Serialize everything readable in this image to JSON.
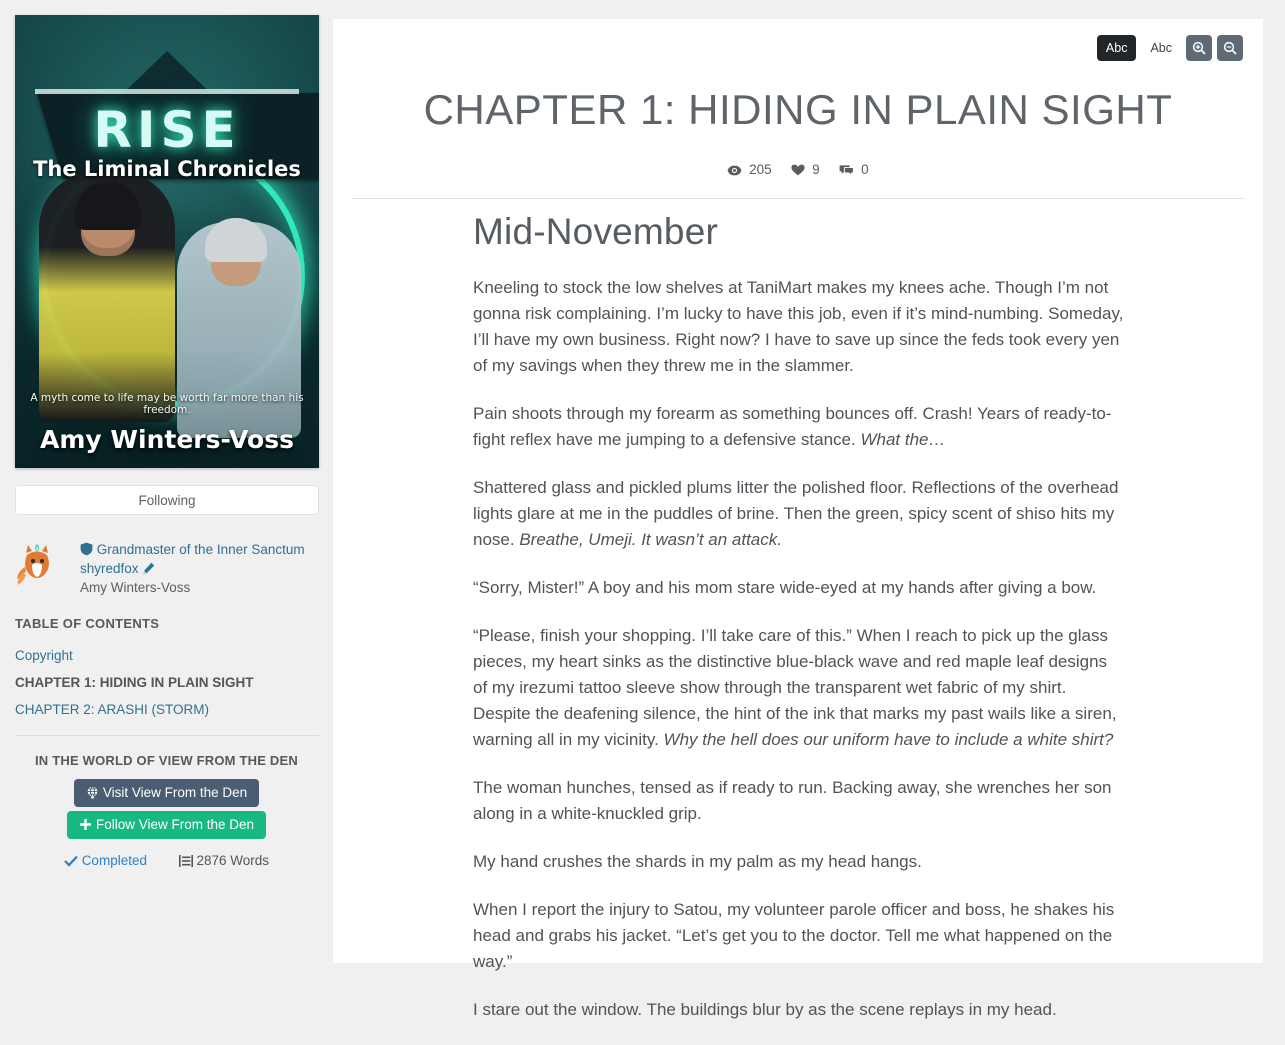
{
  "sidebar": {
    "cover": {
      "title": "RISE",
      "subtitle": "The Liminal Chronicles",
      "tagline": "A myth come to life may be worth far more than his freedom.",
      "author": "Amy Winters-Voss",
      "ring_color": "#34f0c0"
    },
    "follow_button_label": "Following",
    "author": {
      "rank": "Grandmaster of the Inner Sanctum",
      "rank_icon": "shield-icon",
      "handle": "shyredfox",
      "handle_edit_icon": "pencil-icon",
      "real_name": "Amy Winters-Voss",
      "avatar_icon": "fox-avatar-icon"
    },
    "toc_heading": "TABLE OF CONTENTS",
    "toc_items": [
      {
        "label": "Copyright",
        "current": false
      },
      {
        "label": "CHAPTER 1: HIDING IN PLAIN SIGHT",
        "current": true
      },
      {
        "label": "CHAPTER 2: ARASHI (STORM)",
        "current": false
      }
    ],
    "world_heading": "IN THE WORLD OF VIEW FROM THE DEN",
    "visit_button_label": "Visit View From the Den",
    "visit_button_icon": "globe-icon",
    "visit_button_color": "#4a5d72",
    "follow_world_button_label": "Follow View From the Den",
    "follow_world_button_icon": "plus-icon",
    "follow_world_button_color": "#17b981",
    "status_label": "Completed",
    "status_icon": "check-icon",
    "status_color": "#2d7fc1",
    "word_count_label": "2876 Words",
    "word_count_icon": "align-justify-icon"
  },
  "toolbar": {
    "font_serif_label": "Abc",
    "font_sans_label": "Abc",
    "zoom_in_icon": "zoom-in-icon",
    "zoom_out_icon": "zoom-out-icon",
    "active_font_bg": "#22252a"
  },
  "header": {
    "chapter_title": "CHAPTER 1: HIDING IN PLAIN SIGHT",
    "views_count": "205",
    "views_icon": "eye-icon",
    "likes_count": "9",
    "likes_icon": "heart-icon",
    "comments_count": "0",
    "comments_icon": "comments-icon"
  },
  "article": {
    "heading": "Mid-November",
    "paragraphs": [
      {
        "parts": [
          {
            "text": "Kneeling to stock the low shelves at TaniMart makes my knees ache. Though I’m not gonna risk complaining. I’m lucky to have this job, even if it’s mind-numbing. Someday, I’ll have my own business. Right now? I have to save up since the feds took every yen of my savings when they threw me in the slammer.",
            "italic": false
          }
        ]
      },
      {
        "parts": [
          {
            "text": "Pain shoots through my forearm as something bounces off. Crash! Years of ready-to-fight reflex have me jumping to a defensive stance. ",
            "italic": false
          },
          {
            "text": "What the…",
            "italic": true
          }
        ]
      },
      {
        "parts": [
          {
            "text": "Shattered glass and pickled plums litter the polished floor. Reflections of the overhead lights glare at me in the puddles of brine. Then the green, spicy scent of shiso hits my nose. ",
            "italic": false
          },
          {
            "text": "Breathe, Umeji. It wasn’t an attack.",
            "italic": true
          }
        ]
      },
      {
        "parts": [
          {
            "text": "“Sorry, Mister!” A boy and his mom stare wide-eyed at my hands after giving a bow.",
            "italic": false
          }
        ]
      },
      {
        "parts": [
          {
            "text": "“Please, finish your shopping. I’ll take care of this.” When I reach to pick up the glass pieces, my heart sinks as the distinctive blue-black wave and red maple leaf designs of my irezumi tattoo sleeve show through the transparent wet fabric of my shirt. Despite the deafening silence, the hint of the ink that marks my past wails like a siren, warning all in my vicinity. ",
            "italic": false
          },
          {
            "text": "Why the hell does our uniform have to include a white shirt?",
            "italic": true
          }
        ]
      },
      {
        "parts": [
          {
            "text": "The woman hunches, tensed as if ready to run. Backing away, she wrenches her son along in a white-knuckled grip.",
            "italic": false
          }
        ]
      },
      {
        "parts": [
          {
            "text": "My hand crushes the shards in my palm as my head hangs.",
            "italic": false
          }
        ]
      },
      {
        "parts": [
          {
            "text": "When I report the injury to Satou, my volunteer parole officer and boss, he shakes his head and grabs his jacket. “Let’s get you to the doctor. Tell me what happened on the way.”",
            "italic": false
          }
        ]
      },
      {
        "parts": [
          {
            "text": "I stare out the window. The buildings blur by as the scene replays in my head.",
            "italic": false
          }
        ]
      }
    ]
  }
}
